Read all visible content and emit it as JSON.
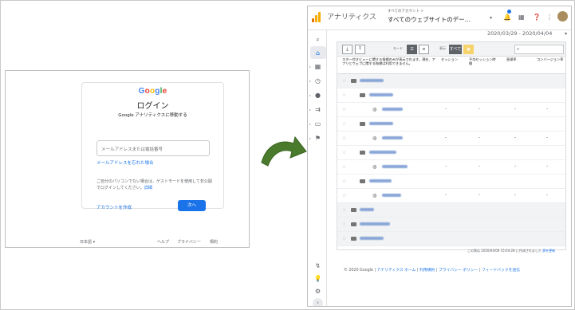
{
  "login": {
    "logo": [
      "G",
      "o",
      "o",
      "g",
      "l",
      "e"
    ],
    "logo_colors": [
      "#4285F4",
      "#EA4335",
      "#FBBC05",
      "#4285F4",
      "#34A853",
      "#EA4335"
    ],
    "title": "ログイン",
    "subtitle": "Google アナリティクスに移動する",
    "email_placeholder": "メールアドレスまたは電話番号",
    "forgot_email": "メールアドレスを忘れた場合",
    "guest_text": "ご自分のパソコンでない場合は、ゲストモードを使用して非公開でログインしてください。",
    "guest_link": "詳細",
    "create_account": "アカウントを作成",
    "next": "次へ",
    "language": "日本語",
    "footer": [
      "ヘルプ",
      "プライバシー",
      "規約"
    ]
  },
  "ga": {
    "app_name": "アナリティクス",
    "account_path": "すべてのアカウント > ",
    "account_view": "すべてのウェブサイトのデー…",
    "date_range": "2020/03/29 - 2020/04/04",
    "toolbar": {
      "mode_label": "モード",
      "show_label": "表示",
      "show_all": "すべて"
    },
    "columns": {
      "notice": "スター付きビューに関する指標のみが表示されます。現在、アプリとウェブに関する指標は利用できません。",
      "sessions": "セッション",
      "avg_duration": "平均セッション時間",
      "bounce_rate": "直帰率",
      "conversion_rate": "コンバージョン率"
    },
    "dash": "-",
    "footnote": "この表は 2020/04/06 15:04:28 に作成されました",
    "refresh": "表を更新",
    "copyright": "© 2020 Google",
    "footer_links": [
      "アナリティクス ホーム",
      "利用規約",
      "プライバシー ポリシー",
      "フィードバックを送信"
    ]
  }
}
